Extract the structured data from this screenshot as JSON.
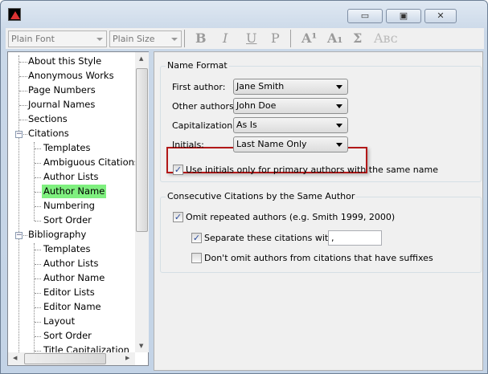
{
  "window": {
    "icon": "endnote-app-icon",
    "buttons": {
      "minimize": "▭",
      "maximize": "▣",
      "close": "✕"
    }
  },
  "toolbar": {
    "font": "Plain Font",
    "size": "Plain Size",
    "bold": "B",
    "italic": "I",
    "underline": "U",
    "plain": "P",
    "superscript": "A¹",
    "subscript": "A₁",
    "symbol": "Σ",
    "smallcaps": "Aʙᴄ"
  },
  "tree": {
    "items": [
      {
        "label": "About this Style",
        "level": 0
      },
      {
        "label": "Anonymous Works",
        "level": 0
      },
      {
        "label": "Page Numbers",
        "level": 0
      },
      {
        "label": "Journal Names",
        "level": 0
      },
      {
        "label": "Sections",
        "level": 0
      },
      {
        "label": "Citations",
        "level": 0,
        "expanded": true
      },
      {
        "label": "Templates",
        "level": 1
      },
      {
        "label": "Ambiguous Citations",
        "level": 1
      },
      {
        "label": "Author Lists",
        "level": 1
      },
      {
        "label": "Author Name",
        "level": 1,
        "selected": true
      },
      {
        "label": "Numbering",
        "level": 1
      },
      {
        "label": "Sort Order",
        "level": 1
      },
      {
        "label": "Bibliography",
        "level": 0,
        "expanded": true
      },
      {
        "label": "Templates",
        "level": 1
      },
      {
        "label": "Author Lists",
        "level": 1
      },
      {
        "label": "Author Name",
        "level": 1
      },
      {
        "label": "Editor Lists",
        "level": 1
      },
      {
        "label": "Editor Name",
        "level": 1
      },
      {
        "label": "Layout",
        "level": 1
      },
      {
        "label": "Sort Order",
        "level": 1
      },
      {
        "label": "Title Capitalization",
        "level": 1
      }
    ],
    "selected_color": "#7ff07f"
  },
  "name_format": {
    "title": "Name Format",
    "first_author": {
      "label": "First author:",
      "value": "Jane Smith"
    },
    "other_authors": {
      "label": "Other authors:",
      "value": "John Doe"
    },
    "capitalization": {
      "label": "Capitalization:",
      "value": "As Is"
    },
    "initials": {
      "label": "Initials:",
      "value": "Last Name Only"
    },
    "use_initials": {
      "label": "Use initials only for primary authors with the same name",
      "checked": true
    },
    "highlight_color": "#b21818"
  },
  "consecutive": {
    "title": "Consecutive Citations by the Same Author",
    "omit": {
      "label": "Omit repeated authors (e.g. Smith 1999, 2000)",
      "checked": true
    },
    "separate": {
      "label": "Separate these citations with:",
      "checked": true,
      "value": ","
    },
    "dont_omit": {
      "label": "Don't omit authors from citations that have suffixes",
      "checked": false
    }
  }
}
